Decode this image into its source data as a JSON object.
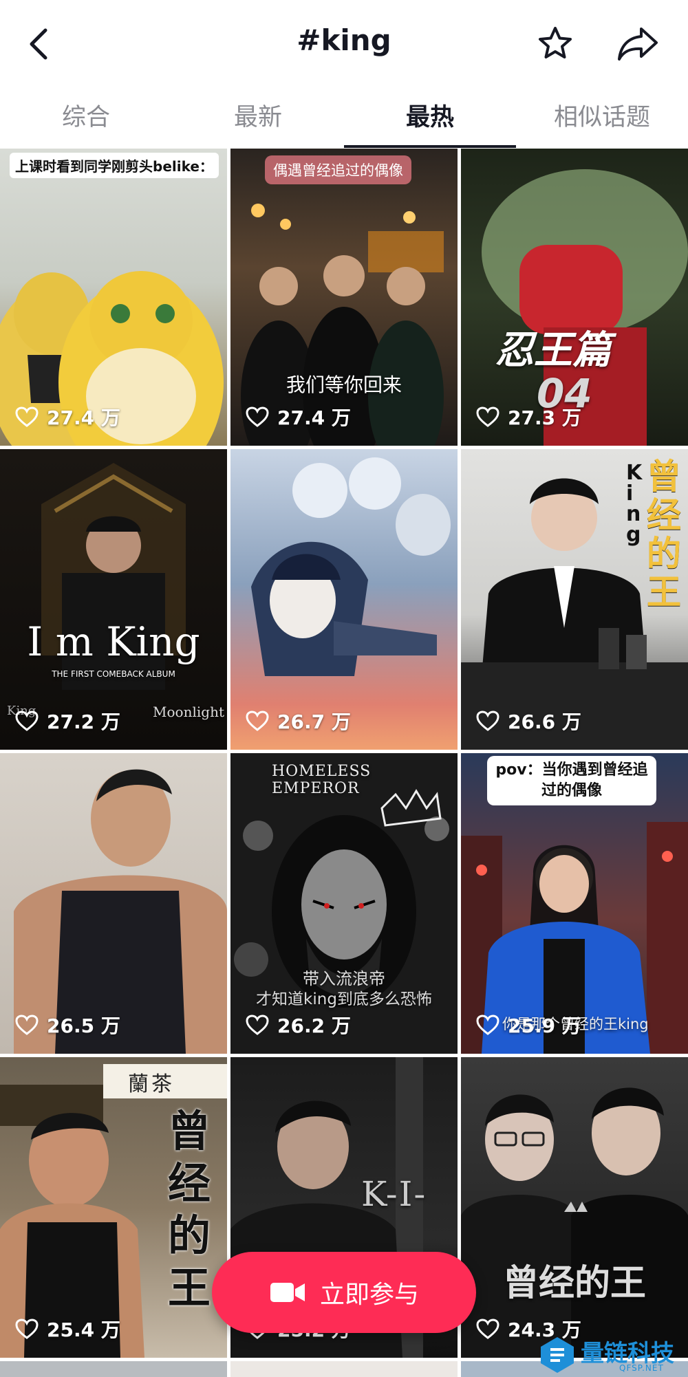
{
  "header": {
    "title": "#king",
    "icons": [
      "back-icon",
      "star-icon",
      "share-icon"
    ]
  },
  "tabs": [
    {
      "label": "综合",
      "active": false
    },
    {
      "label": "最新",
      "active": false
    },
    {
      "label": "最热",
      "active": true
    },
    {
      "label": "相似话题",
      "active": false
    }
  ],
  "videos": [
    {
      "likes": "27.4 万",
      "tag": "上课时看到同学刚剪头belike："
    },
    {
      "likes": "27.4 万",
      "tag": "偶遇曾经追过的偶像",
      "caption": "我们等你回来"
    },
    {
      "likes": "27.3 万",
      "caption": "忍王篇",
      "caption2": "04"
    },
    {
      "likes": "27.2 万",
      "caption": "I m King",
      "caption2": "THE FIRST COMEBACK ALBUM",
      "corner_left": "King",
      "corner_right": "Moonlight"
    },
    {
      "likes": "26.7 万"
    },
    {
      "likes": "26.6 万",
      "caption": "曾经的王",
      "caption2": "King"
    },
    {
      "likes": "26.5 万"
    },
    {
      "likes": "26.2 万",
      "tag": "HOMELESS EMPEROR",
      "caption": "带入流浪帝",
      "caption2": "才知道king到底多么恐怖"
    },
    {
      "likes": "25.9 万",
      "tag": "pov：当你遇到曾经追过的偶像",
      "caption": "你是那个曾经的王king"
    },
    {
      "likes": "25.4 万",
      "caption": "曾经的王",
      "sign": "蘭茶"
    },
    {
      "likes": "25.2 万",
      "caption": "K-I-"
    },
    {
      "likes": "24.3 万",
      "caption": "曾经的王"
    }
  ],
  "fab": {
    "label": "立即参与",
    "icon": "video-camera-icon"
  },
  "watermark": {
    "text": "量链科技",
    "subtext": "QFSP.NET"
  },
  "colors": {
    "accent": "#fe2c55",
    "text": "#161823",
    "muted": "#8a8b91"
  }
}
